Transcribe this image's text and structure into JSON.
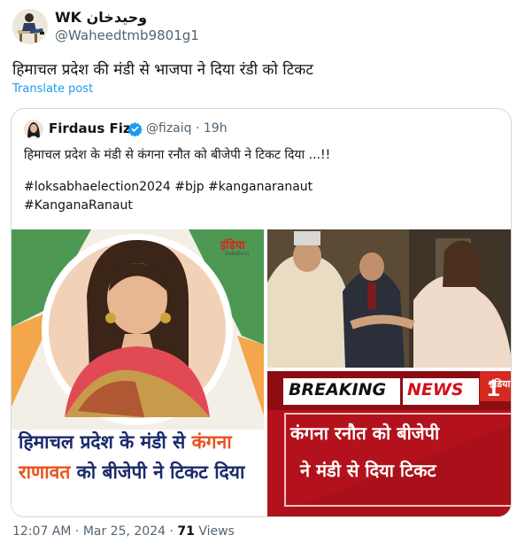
{
  "post": {
    "author_name": "WK وحيدخان",
    "author_handle": "@Waheedtmb9801g1",
    "text": "हिमाचल प्रदेश की मंडी से भाजपा ने दिया रंडी को टिकट",
    "translate_label": "Translate post",
    "time": "12:07 AM",
    "date": "Mar 25, 2024",
    "separator": "·",
    "views_count": "71",
    "views_label": "Views"
  },
  "quote": {
    "author_name": "Firdaus Fiza",
    "author_handle": "@fizaiq",
    "separator": "·",
    "age": "19h",
    "text": "हिमाचल प्रदेश के मंडी से कंगना रनौत को बीजेपी ने टिकट दिया ...!!",
    "hashtags_line1": "#loksabhaelection2024 #bjp #kanganaranaut",
    "hashtags_line2": "#KanganaRanaut"
  },
  "media": {
    "left": {
      "logo": "इंडिया",
      "logo_sub": "indiatv.in",
      "line1_part1": "हिमाचल प्रदेश के मंडी से",
      "line1_part2": "कंगना",
      "line2_part1": "राणावत",
      "line2_part2": "को बीजेपी ने टिकट दिया"
    },
    "right_bottom": {
      "breaking": "BREAKING",
      "news": "NEWS",
      "logo": "इंडिया",
      "line1": "कंगना रनौत को बीजेपी",
      "line2": "ने मंडी से दिया टिकट"
    }
  },
  "colors": {
    "link": "#1d9bf0",
    "secondary_text": "#536471",
    "verified": "#1d9bf0",
    "breaking_red": "#b5121b",
    "caption_navy": "#1b2a6b",
    "caption_orange": "#e8521e"
  },
  "icons": {
    "verified": "verified-badge-icon"
  }
}
